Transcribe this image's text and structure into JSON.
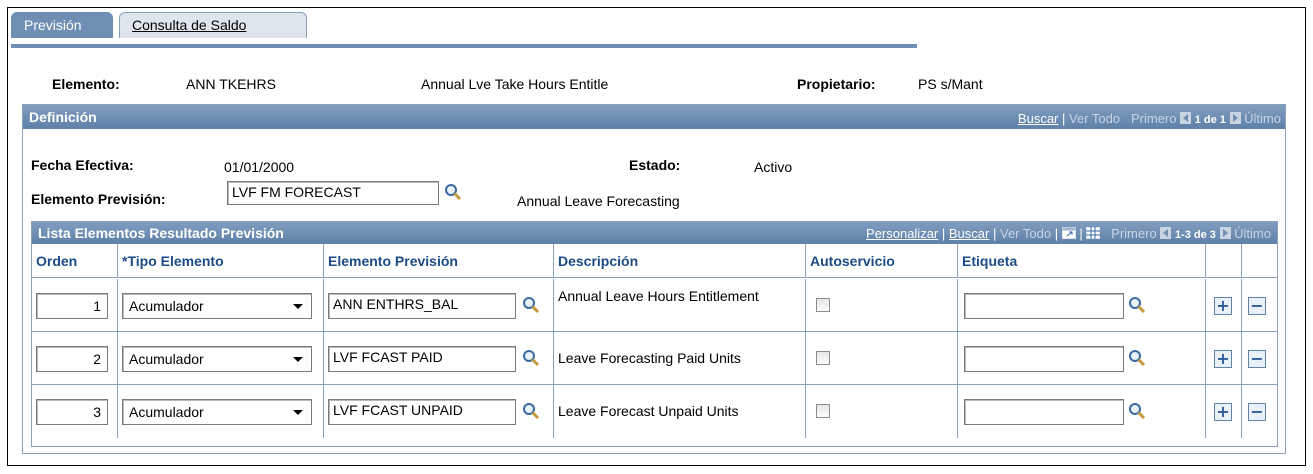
{
  "tabs": [
    {
      "label": "Previsión"
    },
    {
      "label": "Consulta de Saldo"
    }
  ],
  "header": {
    "elemento_label": "Elemento:",
    "elemento_code": "ANN TKEHRS",
    "elemento_desc": "Annual Lve Take Hours Entitle",
    "propietario_label": "Propietario:",
    "propietario_value": "PS s/Mant"
  },
  "definicion": {
    "title": "Definición",
    "nav": {
      "buscar": "Buscar",
      "ver_todo": "Ver Todo",
      "primero": "Primero",
      "count": "1 de 1",
      "ultimo": "Último"
    },
    "fecha_label": "Fecha Efectiva:",
    "fecha_value": "01/01/2000",
    "estado_label": "Estado:",
    "estado_value": "Activo",
    "elem_prev_label": "Elemento Previsión:",
    "elem_prev_value": "LVF FM FORECAST",
    "elem_prev_desc": "Annual Leave Forecasting"
  },
  "grid": {
    "title": "Lista Elementos Resultado Previsión",
    "nav": {
      "personalizar": "Personalizar",
      "buscar": "Buscar",
      "ver_todo": "Ver Todo",
      "primero": "Primero",
      "count": "1-3 de 3",
      "ultimo": "Último"
    },
    "columns": {
      "orden": "Orden",
      "tipo": "*Tipo Elemento",
      "elemento": "Elemento Previsión",
      "descripcion": "Descripción",
      "autoservicio": "Autoservicio",
      "etiqueta": "Etiqueta"
    },
    "rows": [
      {
        "orden": "1",
        "tipo": "Acumulador",
        "elemento": "ANN ENTHRS_BAL",
        "descripcion": "Annual Leave Hours Entitlement",
        "etiqueta": ""
      },
      {
        "orden": "2",
        "tipo": "Acumulador",
        "elemento": "LVF FCAST PAID",
        "descripcion": "Leave Forecasting Paid Units",
        "etiqueta": ""
      },
      {
        "orden": "3",
        "tipo": "Acumulador",
        "elemento": "LVF FCAST UNPAID",
        "descripcion": "Leave Forecast Unpaid Units",
        "etiqueta": ""
      }
    ],
    "add_symbol": "+",
    "remove_symbol": "−"
  }
}
